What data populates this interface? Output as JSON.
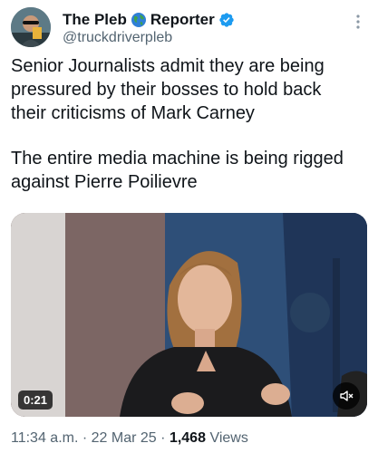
{
  "author": {
    "name_part1": "The Pleb",
    "name_part2": "Reporter",
    "handle": "@truckdriverpleb",
    "avatar_icon": "avatar-person",
    "globe_icon": "globe-icon",
    "verified_icon": "verified-badge-icon",
    "verified_color": "#1d9bf0"
  },
  "tweet": {
    "paragraph1": "Senior Journalists admit they are being pressured by their bosses to hold back their criticisms of Mark Carney",
    "paragraph2": "The entire media machine is being rigged against Pierre Poilievre"
  },
  "media": {
    "duration": "0:21",
    "mute_icon": "speaker-muted-icon"
  },
  "meta": {
    "time": "11:34 a.m.",
    "separator": "·",
    "date": "22 Mar 25",
    "views_count": "1,468",
    "views_label": "Views"
  },
  "colors": {
    "text_primary": "#0f1419",
    "text_secondary": "#536471"
  }
}
